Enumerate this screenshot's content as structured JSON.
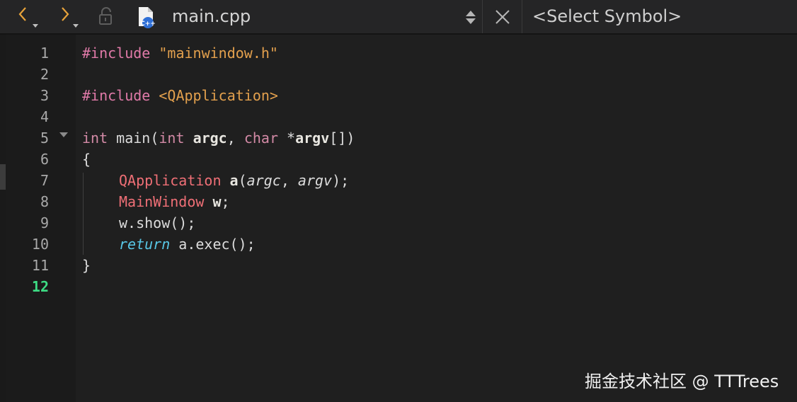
{
  "toolbar": {
    "file_name": "main.cpp",
    "symbol_placeholder": "<Select Symbol>"
  },
  "editor": {
    "line_numbers": [
      "1",
      "2",
      "3",
      "4",
      "5",
      "6",
      "7",
      "8",
      "9",
      "10",
      "11",
      "12"
    ],
    "current_line": "12",
    "code": {
      "l1": {
        "directive": "#include",
        "arg": "\"mainwindow.h\""
      },
      "l3": {
        "directive": "#include",
        "arg": "<QApplication>"
      },
      "l5": {
        "kw1": "int",
        "name": "main(",
        "kw2": "int",
        "p1": "argc",
        "sep": ", ",
        "kw3": "char",
        "star": "*",
        "p2": "argv",
        "end": "[])"
      },
      "l6": "{",
      "l7": {
        "type": "QApplication",
        "var": "a",
        "open": "(",
        "a1": "argc",
        "sep": ", ",
        "a2": "argv",
        "close": ");"
      },
      "l8": {
        "type": "MainWindow",
        "var": "w",
        "end": ";"
      },
      "l9": "w.show();",
      "l10": {
        "kw": "return",
        "rest": "a.exec();"
      },
      "l11": "}"
    }
  },
  "watermark": "掘金技术社区 @ TTTrees",
  "colors": {
    "background": "#1f1f1f",
    "gutter": "#1b1b1b",
    "current_line_number": "#3ddc84",
    "preprocessor": "#e07aa8",
    "string": "#e3a04d",
    "type": "#ef6f76",
    "return_keyword": "#58c7e6",
    "nav_arrows": "#e8a33a"
  },
  "icons": [
    "nav-back-icon",
    "nav-forward-icon",
    "lock-icon",
    "cpp-file-icon",
    "sort-arrows-icon",
    "close-icon",
    "fold-arrow-icon"
  ]
}
